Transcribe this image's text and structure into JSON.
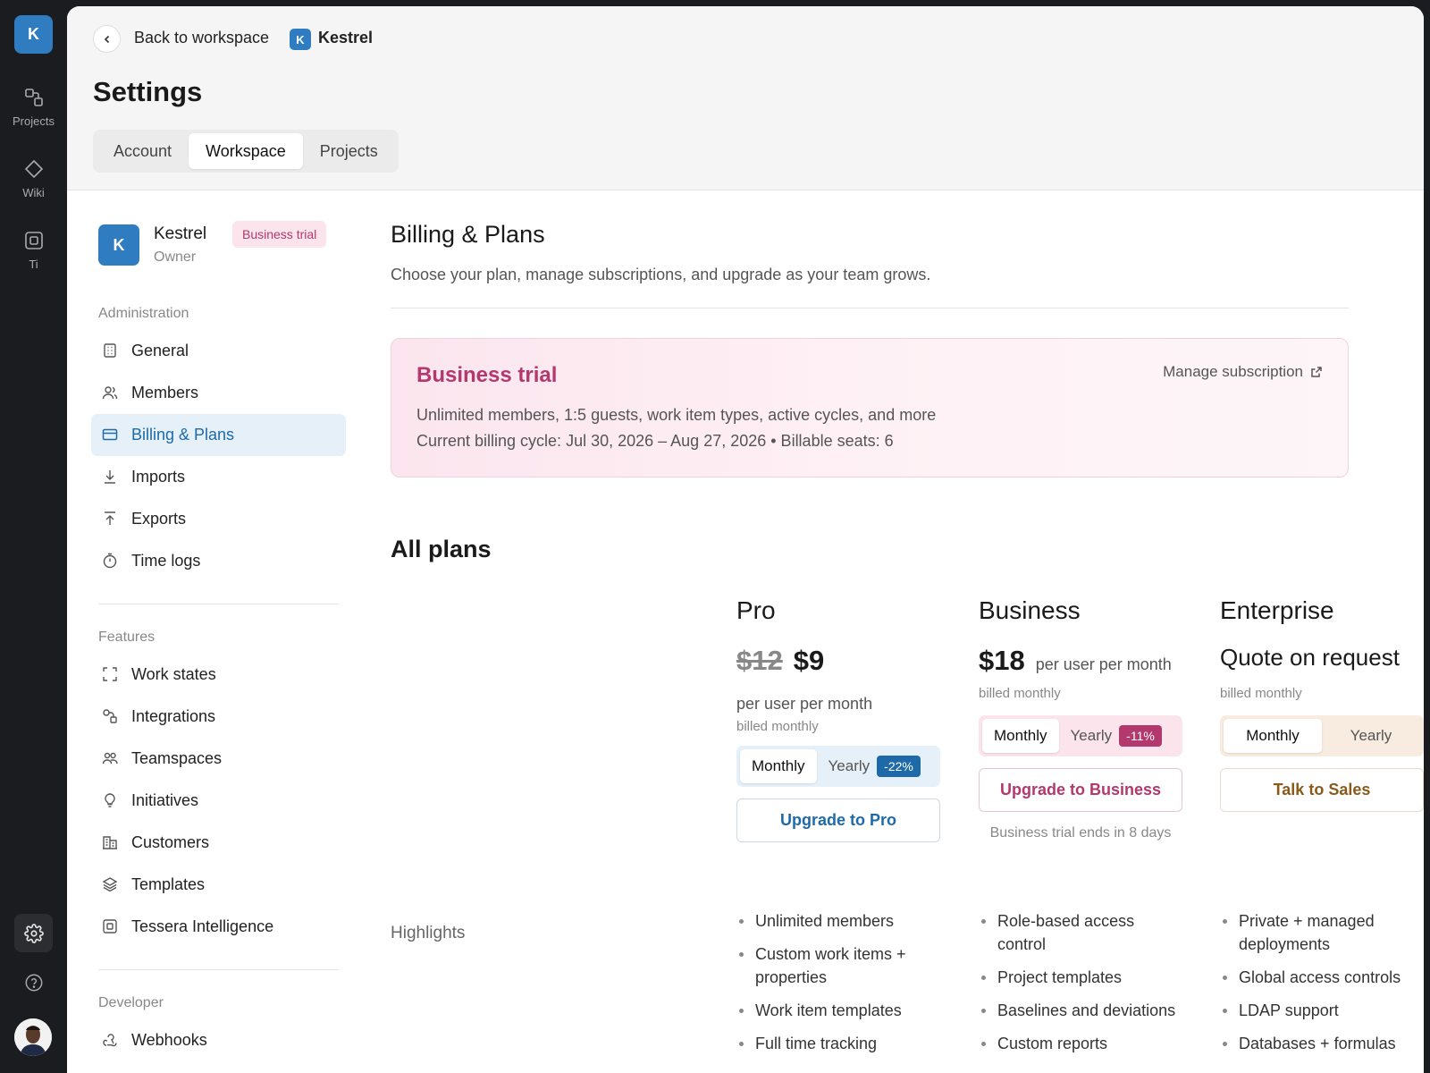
{
  "rail": {
    "logo": "K",
    "items": [
      {
        "label": "Projects",
        "icon": "projects-icon"
      },
      {
        "label": "Wiki",
        "icon": "wiki-icon"
      },
      {
        "label": "Ti",
        "icon": "ti-icon"
      }
    ],
    "bottom": {
      "settings_icon": "gear-icon",
      "help_icon": "help-icon",
      "avatar": "avatar"
    }
  },
  "header": {
    "back_label": "Back to workspace",
    "workspace_badge": "K",
    "workspace_name": "Kestrel",
    "page_title": "Settings",
    "tabs": [
      {
        "label": "Account",
        "active": false
      },
      {
        "label": "Workspace",
        "active": true
      },
      {
        "label": "Projects",
        "active": false
      }
    ]
  },
  "sidebar": {
    "workspace": {
      "logo": "K",
      "name": "Kestrel",
      "role": "Owner",
      "badge": "Business trial"
    },
    "sections": [
      {
        "title": "Administration",
        "items": [
          {
            "label": "General",
            "icon": "building-icon",
            "active": false
          },
          {
            "label": "Members",
            "icon": "users-icon",
            "active": false
          },
          {
            "label": "Billing & Plans",
            "icon": "credit-card-icon",
            "active": true
          },
          {
            "label": "Imports",
            "icon": "download-icon",
            "active": false
          },
          {
            "label": "Exports",
            "icon": "upload-icon",
            "active": false
          },
          {
            "label": "Time logs",
            "icon": "timer-icon",
            "active": false
          }
        ]
      },
      {
        "title": "Features",
        "items": [
          {
            "label": "Work states",
            "icon": "states-icon",
            "active": false
          },
          {
            "label": "Integrations",
            "icon": "integrations-icon",
            "active": false
          },
          {
            "label": "Teamspaces",
            "icon": "teamspaces-icon",
            "active": false
          },
          {
            "label": "Initiatives",
            "icon": "lightbulb-icon",
            "active": false
          },
          {
            "label": "Customers",
            "icon": "customers-icon",
            "active": false
          },
          {
            "label": "Templates",
            "icon": "layers-icon",
            "active": false
          },
          {
            "label": "Tessera Intelligence",
            "icon": "ai-icon",
            "active": false
          }
        ]
      },
      {
        "title": "Developer",
        "items": [
          {
            "label": "Webhooks",
            "icon": "webhook-icon",
            "active": false
          }
        ]
      }
    ]
  },
  "billing": {
    "title": "Billing & Plans",
    "subtitle": "Choose your plan, manage subscriptions, and upgrade as your team grows.",
    "trial_card": {
      "title": "Business trial",
      "manage_label": "Manage subscription",
      "line1": "Unlimited members, 1:5 guests, work item types, active cycles, and more",
      "line2": "Current billing cycle: Jul 30, 2026 – Aug 27, 2026 • Billable seats: 6"
    },
    "all_plans_label": "All plans",
    "highlights_label": "Highlights",
    "plans": [
      {
        "name": "Pro",
        "old_price": "$12",
        "price": "$9",
        "unit": "per user per month",
        "billed": "billed monthly",
        "toggle": {
          "monthly": "Monthly",
          "yearly": "Yearly",
          "discount": "-22%"
        },
        "cta": "Upgrade to Pro",
        "highlights": [
          "Unlimited members",
          "Custom work items + properties",
          "Work item templates",
          "Full time tracking"
        ]
      },
      {
        "name": "Business",
        "price": "$18",
        "unit": "per user per month",
        "billed": "billed monthly",
        "toggle": {
          "monthly": "Monthly",
          "yearly": "Yearly",
          "discount": "-11%"
        },
        "cta": "Upgrade to Business",
        "note": "Business trial ends in 8 days",
        "highlights": [
          "Role-based access control",
          "Project templates",
          "Baselines and deviations",
          "Custom reports"
        ]
      },
      {
        "name": "Enterprise",
        "price": "Quote on request",
        "billed": "billed monthly",
        "toggle": {
          "monthly": "Monthly",
          "yearly": "Yearly"
        },
        "cta": "Talk to Sales",
        "highlights": [
          "Private + managed deployments",
          "Global access controls",
          "LDAP support",
          "Databases + formulas"
        ]
      }
    ]
  },
  "colors": {
    "brand": "#2f7cc0",
    "pro_accent": "#1e6aa8",
    "business_accent": "#b3386d",
    "enterprise_accent": "#8a5a1a"
  }
}
